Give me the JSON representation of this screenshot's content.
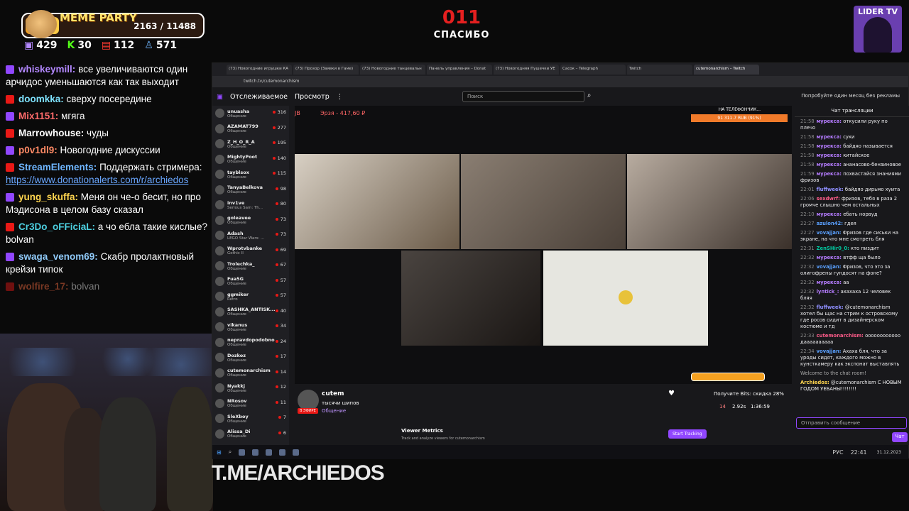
{
  "overlay": {
    "meme_title": "MEME PARTY",
    "meme_count": "2163 / 11488",
    "meme_progress": 0.188,
    "stats": [
      {
        "icon": "twitch-icon",
        "value": "429"
      },
      {
        "icon": "kick-icon",
        "value": "30"
      },
      {
        "icon": "vk-live-icon",
        "value": "112"
      },
      {
        "icon": "user-icon",
        "value": "571"
      }
    ],
    "center_number": "011",
    "center_label": "СПАСИБО",
    "logo_text": "LIDER TV",
    "promo": "T.ME/ARCHIEDOS"
  },
  "stream_chat": [
    {
      "name": "whiskeymill:",
      "color": "#b388ff",
      "text": "все увеличиваются один арчидос уменьшаются как так выходит"
    },
    {
      "name": "doomkka:",
      "color": "#7fe3ff",
      "text": "сверху посередине"
    },
    {
      "name": "Mix1151:",
      "color": "#ff6b6b",
      "text": "мгяга"
    },
    {
      "name": "Marrowhouse:",
      "color": "#ffffff",
      "text": "чуды"
    },
    {
      "name": "p0v1dl9:",
      "color": "#ff8a65",
      "text": "Новогодние дискуссии"
    },
    {
      "name": "StreamElements:",
      "color": "#6fb6ff",
      "text": "Поддержать стримера:",
      "link": "https://www.donationalerts.com/r/archiedos"
    },
    {
      "name": "yung_skuffa:",
      "color": "#ffd54f",
      "text": "Меня он че-о бесит, но про Мэдисона в целом базу сказал"
    },
    {
      "name": "Cr3Do_oFFiciaL:",
      "color": "#4dd0e1",
      "text": "а чо ебла такие кислые? bolvan"
    },
    {
      "name": "swaga_venom69:",
      "color": "#90caf9",
      "text": "Скабр пролактновый крейзи типок"
    },
    {
      "name": "wolfire_17:",
      "color": "#ff7043",
      "text": "bolvan"
    }
  ],
  "browser": {
    "tabs": [
      "(73) Новогодние игрушки КА",
      "(73) Прозор (Заявки в Гаме)",
      "(73) Новогодние танцевальн",
      "Панель управления – Donat",
      "(73) Новогодняя Пушечки УЕ",
      "Сасок – Telegraph",
      "Twitch",
      "cutemonarchism – Twitch"
    ],
    "url": "twitch.tv/cutemonarchism",
    "nav_following": "Отслеживаемое",
    "nav_browse": "Просмотр",
    "search_placeholder": "Поиск",
    "ad_text": "Попробуйте один месяц без рекламы",
    "chat_header": "Чат трансляции",
    "chat_input_placeholder": "Отправить сообщение",
    "chat_button": "Чат",
    "player_top_left": "JB",
    "player_top_label": "Эрзя - 417,60 ₽",
    "phone_box": "НА ТЕЛЕФОНЧИК...",
    "phone_amount": "91 311.7 RUB (91%)",
    "streamer_name": "cutem",
    "stream_title": "тысячи шипов",
    "live_badge": "В ЭФИРЕ",
    "category": "Общение",
    "bits_offer": "Получите Bits: скидка 28%",
    "viewers": "14",
    "stat_value": "2.92s",
    "uptime": "1:36:59",
    "viewer_metrics_title": "Viewer Metrics",
    "viewer_metrics_sub": "Track and analyze viewers for cutemonarchism",
    "start_tracking": "Start Tracking",
    "taskbar_time": "22:41",
    "taskbar_date": "31.12.2023",
    "taskbar_lang": "РУС"
  },
  "channels": [
    {
      "name": "unuasha",
      "game": "Общение",
      "viewers": "316"
    },
    {
      "name": "AZAMAT799",
      "game": "Общение",
      "viewers": "277"
    },
    {
      "name": "Z_H_O_R_A",
      "game": "Общение",
      "viewers": "195"
    },
    {
      "name": "MightyPoot",
      "game": "Общение",
      "viewers": "140"
    },
    {
      "name": "tayblsox",
      "game": "Общение",
      "viewers": "115"
    },
    {
      "name": "TanyaBelkova",
      "game": "Общение",
      "viewers": "98"
    },
    {
      "name": "inv1ve",
      "game": "Serious Sam: Th...",
      "viewers": "80"
    },
    {
      "name": "goleavee",
      "game": "Общение",
      "viewers": "73"
    },
    {
      "name": "Adash",
      "game": "LEGO Star Wars: ...",
      "viewers": "73"
    },
    {
      "name": "Wprotvbanke",
      "game": "Gothic II",
      "viewers": "69"
    },
    {
      "name": "Trolechka_",
      "game": "Общение",
      "viewers": "67"
    },
    {
      "name": "Fua5G",
      "game": "Общение",
      "viewers": "57"
    },
    {
      "name": "ggmiker",
      "game": "Retro",
      "viewers": "57"
    },
    {
      "name": "SASHKA_ANTISK...",
      "game": "Общение",
      "viewers": "40"
    },
    {
      "name": "vikanus",
      "game": "Общение",
      "viewers": "34"
    },
    {
      "name": "nepravdopodobno",
      "game": "Общение",
      "viewers": "24"
    },
    {
      "name": "Dozkoz",
      "game": "Общение",
      "viewers": "17"
    },
    {
      "name": "cutemonarchism",
      "game": "Общение",
      "viewers": "14"
    },
    {
      "name": "Nyakkj",
      "game": "Общение",
      "viewers": "12"
    },
    {
      "name": "NRosov",
      "game": "Общение",
      "viewers": "11"
    },
    {
      "name": "SleXboy",
      "game": "Общение",
      "viewers": "7"
    },
    {
      "name": "Alissa_Di",
      "game": "Общение",
      "viewers": "6"
    }
  ],
  "twitch_chat": [
    {
      "time": "21:58",
      "user": "мурексa:",
      "color": "#b57cff",
      "text": "откусили руку по плечо"
    },
    {
      "time": "21:58",
      "user": "мурексa:",
      "color": "#b57cff",
      "text": "суки"
    },
    {
      "time": "21:58",
      "user": "мурексa:",
      "color": "#b57cff",
      "text": "байдяо называется"
    },
    {
      "time": "21:58",
      "user": "мурексa:",
      "color": "#b57cff",
      "text": "китайское"
    },
    {
      "time": "21:58",
      "user": "мурексa:",
      "color": "#b57cff",
      "text": "ананасово-бензиновое"
    },
    {
      "time": "21:59",
      "user": "мурексa:",
      "color": "#b57cff",
      "text": "похвастайся знаниями фризов"
    },
    {
      "time": "22:01",
      "user": "fluffweek:",
      "color": "#8f8fff",
      "text": "байдяо дирьмо хуита"
    },
    {
      "time": "22:06",
      "user": "sexdwrf:",
      "color": "#ff5c8a",
      "text": "фризов, тебя в раза 2 громче слышно чем остальных"
    },
    {
      "time": "22:10",
      "user": "мурексa:",
      "color": "#b57cff",
      "text": "ебать норвуд"
    },
    {
      "time": "22:27",
      "user": "azulon42:",
      "color": "#5aa0ff",
      "text": "гдея"
    },
    {
      "time": "22:27",
      "user": "vovajjan:",
      "color": "#5aa0ff",
      "text": "Фризов где сиськи на экране, на что мне смотреть бля"
    },
    {
      "time": "22:31",
      "user": "ZenSHir0_0:",
      "color": "#00c8a0",
      "text": "кто пиздит"
    },
    {
      "time": "22:32",
      "user": "мурексa:",
      "color": "#b57cff",
      "text": "втфф ща было"
    },
    {
      "time": "22:32",
      "user": "vovajjan:",
      "color": "#5aa0ff",
      "text": "Фризов, что это за олигофрены гундосят на фоне?"
    },
    {
      "time": "22:32",
      "user": "мурексa:",
      "color": "#b57cff",
      "text": "аа"
    },
    {
      "time": "22:32",
      "user": "lyntick_:",
      "color": "#b57cff",
      "text": "ахахаха 12 человек бляя"
    },
    {
      "time": "22:32",
      "user": "fluffweek:",
      "color": "#8f8fff",
      "text": "@cutemonarchism хотел бы щас на стрим к островскому где росов сидит в дизайнерском костюме и тд"
    },
    {
      "time": "22:33",
      "user": "cutemonarchism:",
      "color": "#ff5c8a",
      "text": "оооооооооооо даааааааааа"
    },
    {
      "time": "22:34",
      "user": "vovajjan:",
      "color": "#5aa0ff",
      "text": "Ахаха бля, что за уроды сидят, каждого можно в кунсткамеру как экспонат выставлять"
    },
    {
      "time": "",
      "user": "",
      "color": "#aaaaaa",
      "text": "Welcome to the chat room!"
    },
    {
      "time": "",
      "user": "Archiedos:",
      "color": "#ffd54f",
      "text": "@cutemonarchism С НОВЫМ ГОДОМ УЕБАНЫ!!!!!!!!"
    }
  ],
  "colors": {
    "twitch_purple": "#9147ff",
    "live_red": "#e91916",
    "accent_red": "#e52020"
  }
}
